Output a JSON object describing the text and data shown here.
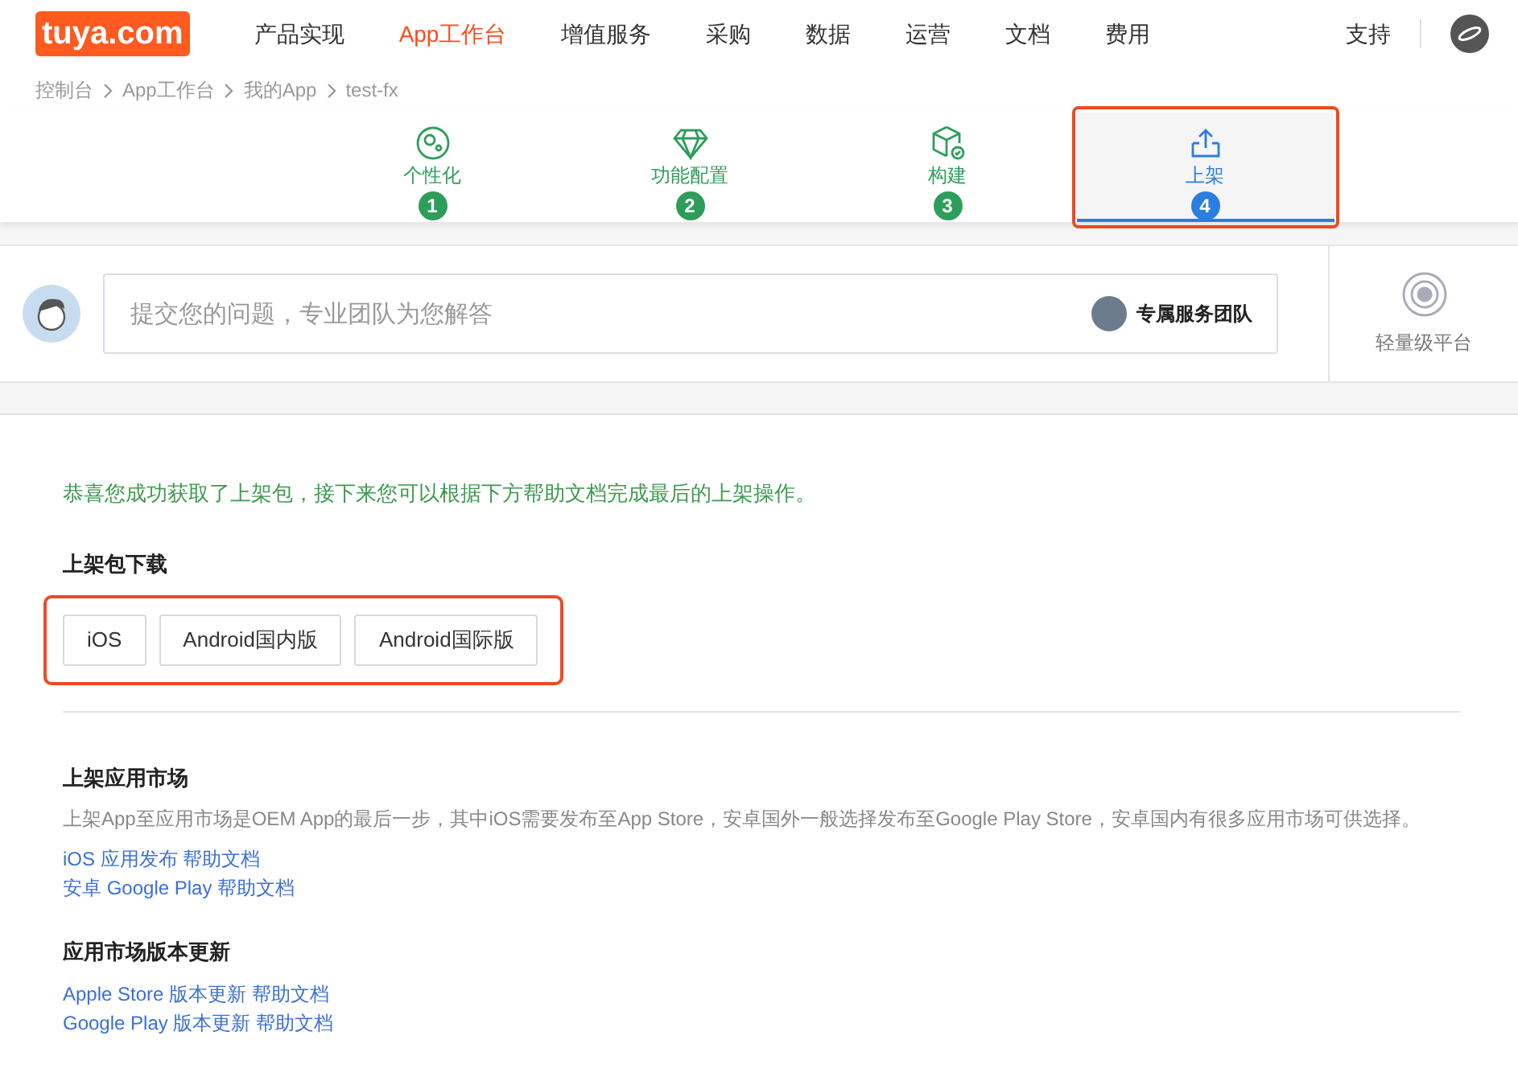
{
  "logo": {
    "text": "tuya.com"
  },
  "nav": [
    {
      "label": "产品实现",
      "selected": false
    },
    {
      "label": "App工作台",
      "selected": true
    },
    {
      "label": "增值服务",
      "selected": false
    },
    {
      "label": "采购",
      "selected": false
    },
    {
      "label": "数据",
      "selected": false
    },
    {
      "label": "运营",
      "selected": false
    },
    {
      "label": "文档",
      "selected": false
    },
    {
      "label": "费用",
      "selected": false
    }
  ],
  "support": "支持",
  "breadcrumb": [
    "控制台",
    "App工作台",
    "我的App",
    "test-fx"
  ],
  "steps": [
    {
      "kind": "gear",
      "label": "个性化",
      "number": "1",
      "selected": false,
      "highlighted": false
    },
    {
      "kind": "diamond",
      "label": "功能配置",
      "number": "2",
      "selected": false,
      "highlighted": false
    },
    {
      "kind": "cube",
      "label": "构建",
      "number": "3",
      "selected": false,
      "highlighted": false
    },
    {
      "kind": "upload",
      "label": "上架",
      "number": "4",
      "selected": true,
      "highlighted": true
    }
  ],
  "question": {
    "placeholder": "提交您的问题，专业团队为您解答",
    "team": "专属服务团队"
  },
  "side_panel": {
    "label": "轻量级平台"
  },
  "success_message": "恭喜您成功获取了上架包，接下来您可以根据下方帮助文档完成最后的上架操作。",
  "download": {
    "title": "上架包下载",
    "highlighted": true,
    "buttons": [
      "iOS",
      "Android国内版",
      "Android国际版"
    ]
  },
  "sections": [
    {
      "title": "上架应用市场",
      "description": "上架App至应用市场是OEM App的最后一步，其中iOS需要发布至App Store，安卓国外一般选择发布至Google Play Store，安卓国内有很多应用市场可供选择。",
      "links": [
        "iOS 应用发布 帮助文档",
        "安卓 Google Play 帮助文档"
      ]
    },
    {
      "title": "应用市场版本更新",
      "links": [
        "Apple Store 版本更新 帮助文档",
        "Google Play 版本更新 帮助文档"
      ]
    }
  ]
}
